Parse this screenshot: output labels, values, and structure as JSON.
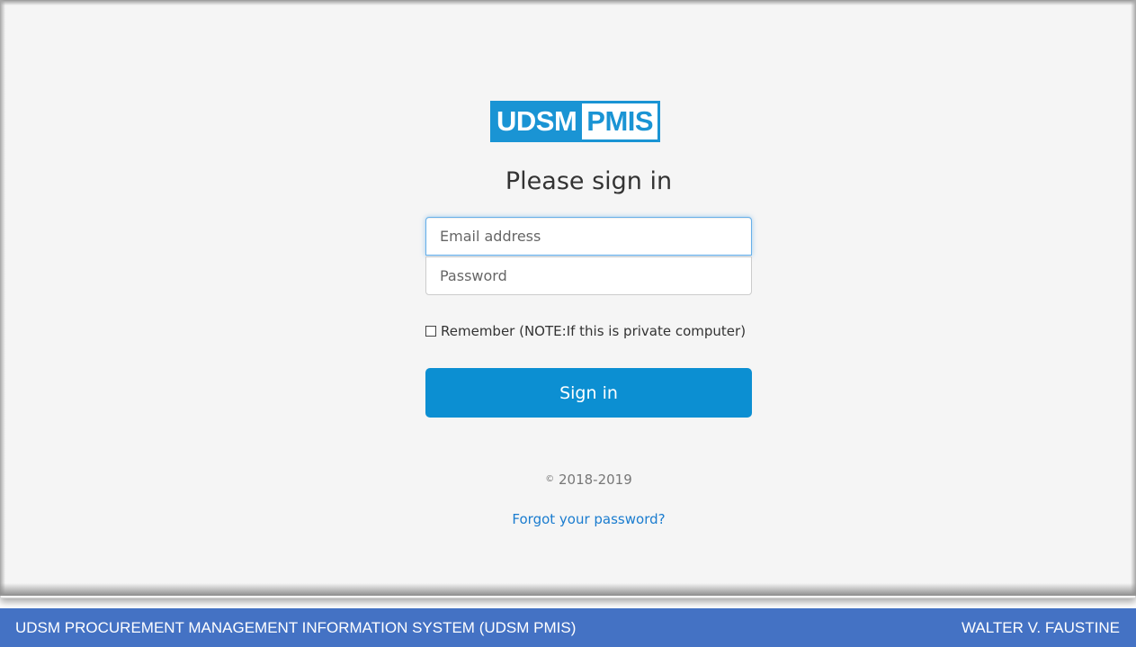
{
  "logo": {
    "part1": "UDSM",
    "part2": "PMIS"
  },
  "login": {
    "heading": "Please sign in",
    "email_placeholder": "Email address",
    "password_placeholder": "Password",
    "remember_label": "Remember (NOTE:If this is private computer)",
    "sign_in_label": "Sign in",
    "copyright_symbol": "©",
    "copyright_years": "2018-2019",
    "forgot_link": "Forgot your password?"
  },
  "caption": {
    "system_name": "UDSM PROCUREMENT MANAGEMENT INFORMATION SYSTEM (UDSM PMIS)",
    "author": "WALTER V. FAUSTINE"
  },
  "colors": {
    "brand_blue": "#1a94d4",
    "button_blue": "#0c8fd2",
    "link_blue": "#1a7ccf",
    "caption_bar": "#4472c4",
    "page_background": "#f5f5f5"
  }
}
